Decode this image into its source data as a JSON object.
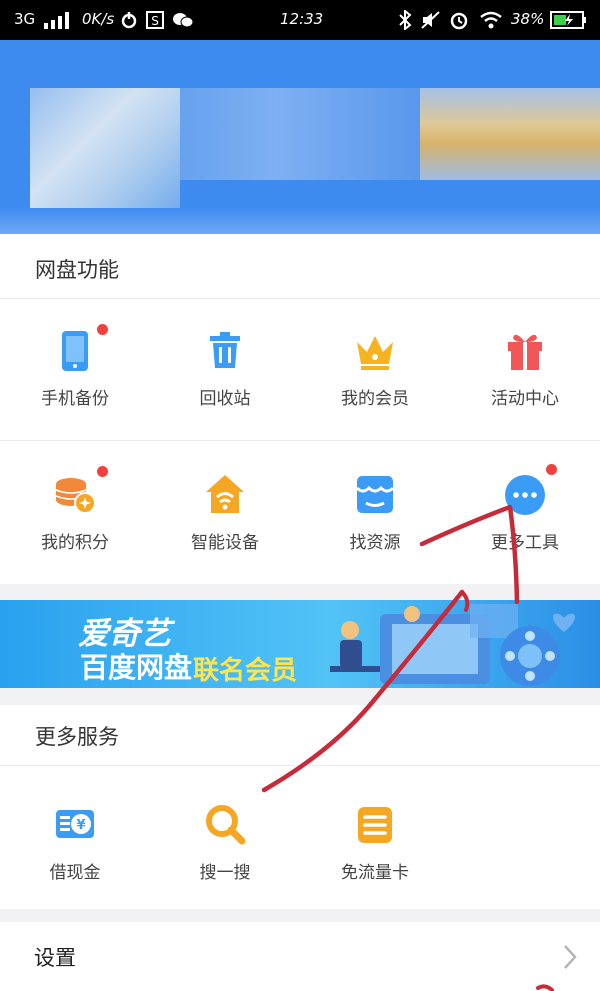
{
  "status_bar": {
    "network": "3G",
    "speed": "0K/s",
    "time": "12:33",
    "battery": "38%"
  },
  "disk_functions": {
    "title": "网盘功能",
    "items": [
      {
        "label": "手机备份",
        "icon": "phone-backup-icon",
        "badge": true
      },
      {
        "label": "回收站",
        "icon": "trash-icon",
        "badge": false
      },
      {
        "label": "我的会员",
        "icon": "crown-icon",
        "badge": false
      },
      {
        "label": "活动中心",
        "icon": "gift-icon",
        "badge": false
      },
      {
        "label": "我的积分",
        "icon": "coins-icon",
        "badge": true
      },
      {
        "label": "智能设备",
        "icon": "smart-home-icon",
        "badge": false
      },
      {
        "label": "找资源",
        "icon": "store-icon",
        "badge": false
      },
      {
        "label": "更多工具",
        "icon": "more-icon",
        "badge": true
      }
    ]
  },
  "banner": {
    "line1": "爱奇艺",
    "line2": "百度网盘",
    "line3": "联名会员"
  },
  "more_services": {
    "title": "更多服务",
    "items": [
      {
        "label": "借现金",
        "icon": "cash-loan-icon"
      },
      {
        "label": "搜一搜",
        "icon": "search-icon"
      },
      {
        "label": "免流量卡",
        "icon": "data-card-icon"
      }
    ]
  },
  "settings": {
    "label": "设置"
  },
  "colors": {
    "header_blue": "#3e8bf0",
    "accent_blue": "#3a9cf4",
    "accent_orange": "#f5a623",
    "badge_red": "#f0413f",
    "annotation_red": "#c62b3a"
  }
}
